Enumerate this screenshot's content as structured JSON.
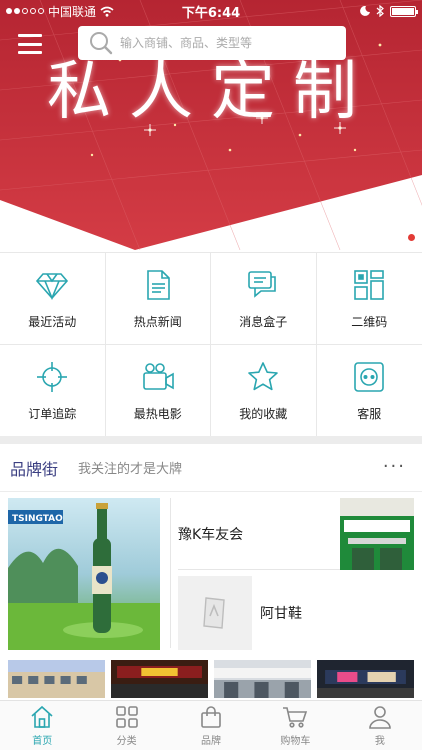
{
  "status_bar": {
    "carrier": "中国联通",
    "time": "下午6:44"
  },
  "banner": {
    "title": "私人定制",
    "search_placeholder": "输入商铺、商品、类型等",
    "colors": {
      "primary": "#c8303a",
      "dark": "#9e1f2a"
    }
  },
  "grid": [
    {
      "label": "最近活动",
      "icon": "diamond-icon"
    },
    {
      "label": "热点新闻",
      "icon": "document-icon"
    },
    {
      "label": "消息盒子",
      "icon": "message-box-icon"
    },
    {
      "label": "二维码",
      "icon": "qrcode-icon"
    },
    {
      "label": "订单追踪",
      "icon": "crosshair-icon"
    },
    {
      "label": "最热电影",
      "icon": "video-camera-icon"
    },
    {
      "label": "我的收藏",
      "icon": "star-icon"
    },
    {
      "label": "客服",
      "icon": "customer-service-icon"
    }
  ],
  "brand": {
    "title": "品牌街",
    "subtitle": "我关注的才是大牌",
    "more": "···",
    "shops": [
      {
        "name": "豫K车友会"
      },
      {
        "name": "阿甘鞋"
      }
    ],
    "feature_image_text": "TSINGTAO"
  },
  "tabbar": [
    {
      "label": "首页",
      "icon": "home-icon",
      "active": true
    },
    {
      "label": "分类",
      "icon": "category-icon",
      "active": false
    },
    {
      "label": "品牌",
      "icon": "bag-icon",
      "active": false
    },
    {
      "label": "购物车",
      "icon": "cart-icon",
      "active": false
    },
    {
      "label": "我",
      "icon": "user-icon",
      "active": false
    }
  ],
  "accent_color": "#2aa6b0"
}
